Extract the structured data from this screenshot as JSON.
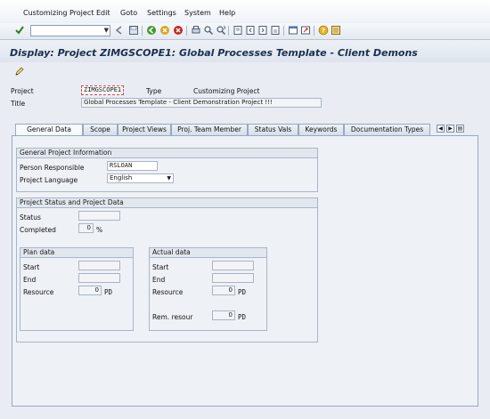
{
  "menu": {
    "customizing_project": "Customizing Project",
    "edit": "Edit",
    "goto": "Goto",
    "settings": "Settings",
    "system": "System",
    "help": "Help"
  },
  "toolbar": {
    "command_field": "",
    "icons": [
      "enter-check-icon",
      "save-icon",
      "back-icon",
      "exit-icon",
      "cancel-icon",
      "print-icon",
      "find-icon",
      "find-next-icon",
      "first-page-icon",
      "prev-page-icon",
      "next-page-icon",
      "last-page-icon",
      "create-session-icon",
      "shortcut-icon",
      "help-icon",
      "layout-menu-icon"
    ]
  },
  "title": "Display: Project ZIMGSCOPE1: Global Processes Template - Client Demons",
  "header": {
    "project_label": "Project",
    "project_value": "ZIMGSCOPE1",
    "type_label": "Type",
    "type_value": "Customizing Project",
    "title_label": "Title",
    "title_value": "Global Processes Template - Client Demonstration Project !!!"
  },
  "tabs": [
    "General Data",
    "Scope",
    "Project Views",
    "Proj. Team Member",
    "Status Vals",
    "Keywords",
    "Documentation Types"
  ],
  "active_tab": "General Data",
  "general_info": {
    "heading": "General Project Information",
    "person_label": "Person Responsible",
    "person_value": "RSLOAN",
    "language_label": "Project Language",
    "language_value": "English"
  },
  "status_data": {
    "heading": "Project Status and Project Data",
    "status_label": "Status",
    "status_value": "",
    "completed_label": "Completed",
    "completed_value": "0",
    "completed_unit": "%"
  },
  "plan": {
    "heading": "Plan data",
    "start_label": "Start",
    "end_label": "End",
    "resource_label": "Resource",
    "resource_value": "0",
    "resource_unit": "PD"
  },
  "actual": {
    "heading": "Actual data",
    "start_label": "Start",
    "end_label": "End",
    "resource_label": "Resource",
    "resource_value": "0",
    "resource_unit": "PD",
    "remaining_label": "Rem. resour",
    "remaining_value": "0",
    "remaining_unit": "PD"
  }
}
